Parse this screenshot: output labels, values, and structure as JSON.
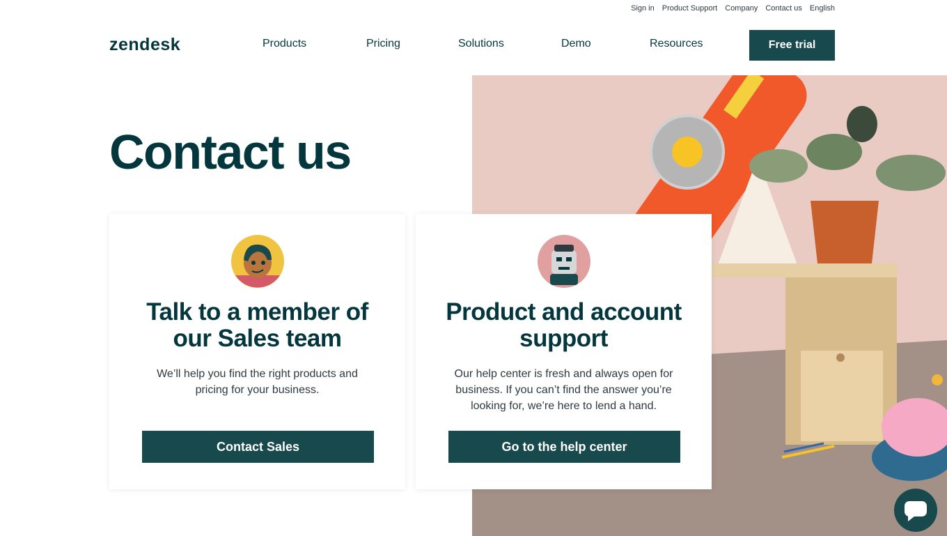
{
  "utility_nav": [
    "Sign in",
    "Product Support",
    "Company",
    "Contact us",
    "English"
  ],
  "brand": {
    "logo": "zendesk"
  },
  "main_nav": {
    "items": [
      "Products",
      "Pricing",
      "Solutions",
      "Demo",
      "Resources"
    ],
    "cta": "Free trial"
  },
  "hero": {
    "title": "Contact us"
  },
  "cards": [
    {
      "title": "Talk to a member of our Sales team",
      "description": "We’ll help you find the right products and pricing for your business.",
      "button": "Contact Sales"
    },
    {
      "title": "Product and account support",
      "description": "Our help center is fresh and always open for business. If you can’t find the answer you’re looking for, we’re here to lend a hand.",
      "button": "Go to the help center"
    }
  ],
  "colors": {
    "brand": "#03363d",
    "button": "#17494d",
    "hero_bg": "#e9c7c0",
    "phone": "#f1582a"
  },
  "icons": {
    "chat": "chat-bubble-icon"
  }
}
